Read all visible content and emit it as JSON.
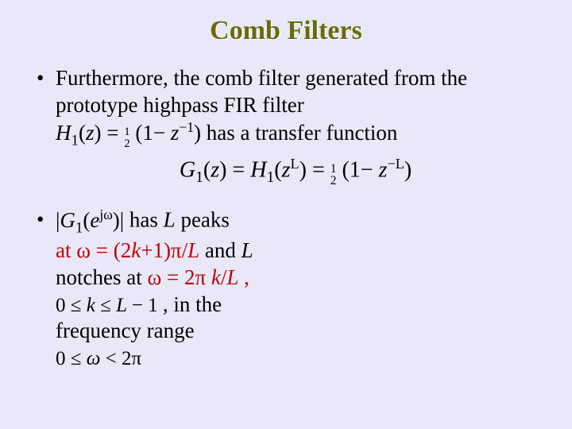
{
  "title": "Comb Filters",
  "b1": {
    "pre": "Furthermore, the comb filter generated from the prototype highpass FIR filter",
    "eq1": {
      "H": "H",
      "sub1": "1",
      "z": "z",
      "one": "1",
      "two": "2",
      "minus": "−",
      "zpow": "−1"
    },
    "mid": "has a transfer function",
    "eq2": {
      "G": "G",
      "sub1": "1",
      "z": "z",
      "H": "H",
      "L": "L",
      "frac1": "1",
      "frac2": "2",
      "minus": "−",
      "zL": "−L"
    }
  },
  "b2": {
    "mag": {
      "bar": "|",
      "G": "G",
      "sub1": "1",
      "e": "e",
      "jw": "jω",
      "close": ")|"
    },
    "has": "has",
    "L": "L",
    "peaks": "peaks",
    "at_pre": "at ω = (2",
    "k": "k",
    "plus1pi": "+1)π/",
    "L2": "L",
    "and": "and",
    "L3": "L",
    "notches_at": "notches at ω = 2π ",
    "k2": "k",
    "overL": "/",
    "L4": "L",
    "comma": ",",
    "range1": {
      "zero": "0",
      "le1": "≤",
      "k": "k",
      "le2": "≤",
      "L": "L",
      "minus1": "− 1"
    },
    "in_the": ", in the",
    "freq_range": "frequency range",
    "range2": {
      "zero": "0",
      "le1": "≤",
      "w": "ω",
      "lt": "<",
      "twopi": "2π"
    }
  }
}
